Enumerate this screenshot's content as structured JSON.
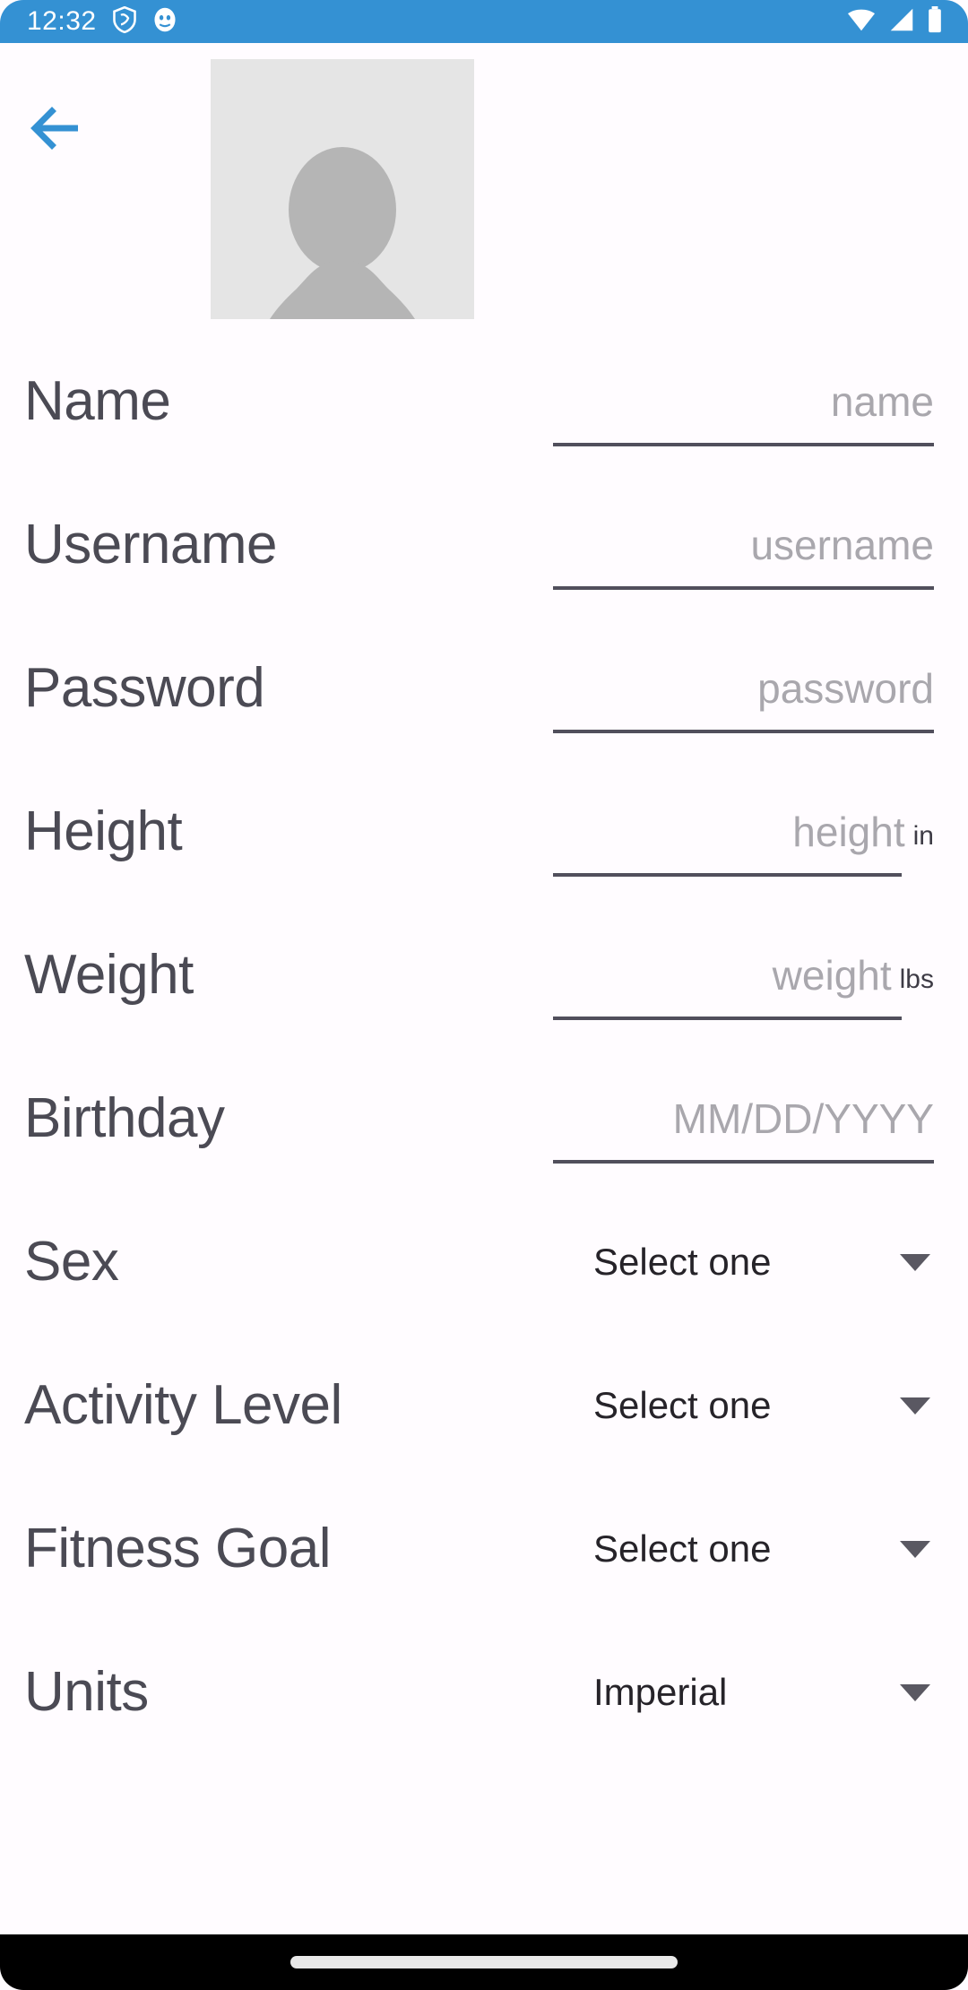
{
  "status_bar": {
    "time": "12:32",
    "left_icons": [
      "shield-icon",
      "app-badge-icon"
    ],
    "right_icons": [
      "wifi-icon",
      "cellular-signal-icon",
      "battery-icon"
    ],
    "background_color": "#3491d3",
    "foreground_color": "#ffffff"
  },
  "header": {
    "back_label": "back-arrow",
    "accent_color": "#3491d3",
    "avatar_alt": "profile-photo-placeholder",
    "avatar_bg": "#e5e5e5",
    "avatar_fg": "#b5b5b5"
  },
  "form": {
    "fields": [
      {
        "label": "Name",
        "kind": "text",
        "value": "",
        "placeholder": "name",
        "unit": ""
      },
      {
        "label": "Username",
        "kind": "text",
        "value": "",
        "placeholder": "username",
        "unit": ""
      },
      {
        "label": "Password",
        "kind": "password",
        "value": "",
        "placeholder": "password",
        "unit": ""
      },
      {
        "label": "Height",
        "kind": "number",
        "value": "",
        "placeholder": "height",
        "unit": "in"
      },
      {
        "label": "Weight",
        "kind": "number",
        "value": "",
        "placeholder": "weight",
        "unit": "lbs"
      },
      {
        "label": "Birthday",
        "kind": "date",
        "value": "",
        "placeholder": "MM/DD/YYYY",
        "unit": ""
      },
      {
        "label": "Sex",
        "kind": "select",
        "value": "Select one",
        "placeholder": "",
        "unit": ""
      },
      {
        "label": "Activity Level",
        "kind": "select",
        "value": "Select one",
        "placeholder": "",
        "unit": ""
      },
      {
        "label": "Fitness Goal",
        "kind": "select",
        "value": "Select one",
        "placeholder": "",
        "unit": ""
      },
      {
        "label": "Units",
        "kind": "select",
        "value": "Imperial",
        "placeholder": "",
        "unit": ""
      }
    ]
  },
  "nav_bar": {
    "home_indicator": "home-indicator",
    "background_color": "#000000"
  }
}
